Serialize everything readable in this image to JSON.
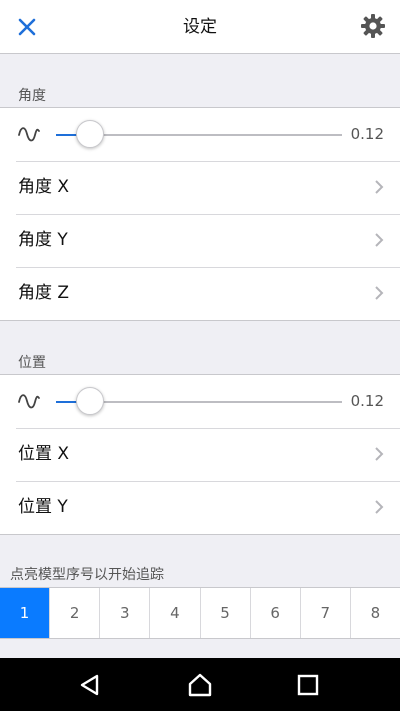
{
  "header": {
    "title": "设定",
    "close_icon": "close-icon",
    "settings_icon": "gear-icon"
  },
  "colors": {
    "accent": "#1e6fd9",
    "selected_tab": "#0a7bff"
  },
  "angle": {
    "section_title": "角度",
    "slider": {
      "icon": "wave-icon",
      "value": 0.12,
      "value_label": "0.12"
    },
    "items": [
      {
        "label": "角度 X"
      },
      {
        "label": "角度 Y"
      },
      {
        "label": "角度 Z"
      }
    ]
  },
  "position": {
    "section_title": "位置",
    "slider": {
      "icon": "wave-icon",
      "value": 0.12,
      "value_label": "0.12"
    },
    "items": [
      {
        "label": "位置 X"
      },
      {
        "label": "位置 Y"
      }
    ]
  },
  "tracking": {
    "section_title": "点亮模型序号以开始追踪",
    "models": [
      "1",
      "2",
      "3",
      "4",
      "5",
      "6",
      "7",
      "8"
    ],
    "selected_index": 0
  },
  "system_nav": {
    "back_icon": "back-triangle-icon",
    "home_icon": "home-icon",
    "recents_icon": "recents-square-icon"
  }
}
